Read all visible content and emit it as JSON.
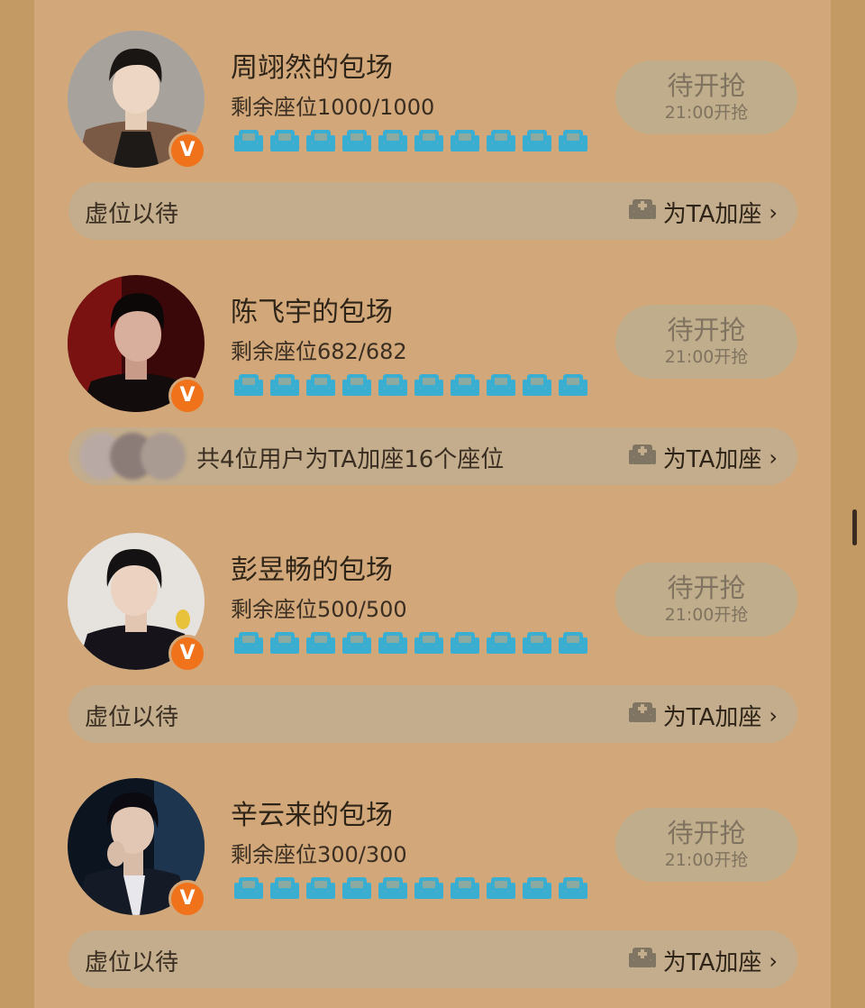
{
  "cards": [
    {
      "title": "周翊然的包场",
      "seats": "剩余座位1000/1000",
      "button": {
        "main": "待开抢",
        "sub": "21:00开抢"
      },
      "bar_text": "虚位以待",
      "bar_action": "为TA加座"
    },
    {
      "title": "陈飞宇的包场",
      "seats": "剩余座位682/682",
      "button": {
        "main": "待开抢",
        "sub": "21:00开抢"
      },
      "bar_text": "共4位用户为TA加座16个座位",
      "bar_action": "为TA加座"
    },
    {
      "title": "彭昱畅的包场",
      "seats": "剩余座位500/500",
      "button": {
        "main": "待开抢",
        "sub": "21:00开抢"
      },
      "bar_text": "虚位以待",
      "bar_action": "为TA加座"
    },
    {
      "title": "辛云来的包场",
      "seats": "剩余座位300/300",
      "button": {
        "main": "待开抢",
        "sub": "21:00开抢"
      },
      "bar_text": "虚位以待",
      "bar_action": "为TA加座"
    }
  ],
  "badge_letter": "V",
  "chevron": "›",
  "icons": {
    "seat": "armchair-icon",
    "add_seat": "add-seat-icon",
    "verified": "verified-v-icon"
  },
  "colors": {
    "seat": "#3aaed0",
    "badge": "#f0731c",
    "button_bg": "#bfad8c",
    "bar_bg": "#c3ad8c",
    "panel": "#d2a87a"
  }
}
